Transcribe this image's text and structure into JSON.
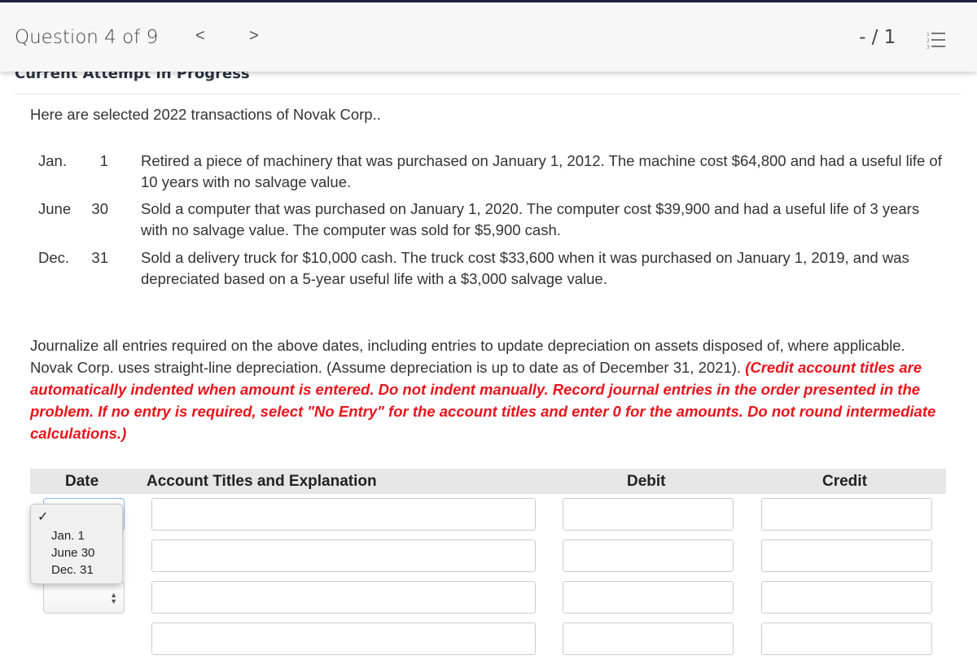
{
  "header": {
    "question_label": "Question 4 of 9",
    "prev": "<",
    "next": ">",
    "score": "- / 1",
    "list_icon": "numbered-list-icon"
  },
  "attempt_label": "Current Attempt in Progress",
  "intro": "Here are selected 2022 transactions of Novak Corp..",
  "transactions": [
    {
      "month": "Jan.",
      "day": "1",
      "text": "Retired a piece of machinery that was purchased on January 1, 2012. The machine cost $64,800 and had a useful life of 10 years with no salvage value."
    },
    {
      "month": "June",
      "day": "30",
      "text": "Sold a computer that was purchased on January 1, 2020. The computer cost $39,900 and had a useful life of 3 years with no salvage value. The computer was sold for $5,900 cash."
    },
    {
      "month": "Dec.",
      "day": "31",
      "text": "Sold a delivery truck for $10,000 cash. The truck cost $33,600 when it was purchased on January 1, 2019, and was depreciated based on a 5-year useful life with a $3,000 salvage value."
    }
  ],
  "instructions": {
    "normal": "Journalize all entries required on the above dates, including entries to update depreciation on assets disposed of, where applicable. Novak Corp. uses straight-line depreciation. (Assume depreciation is up to date as of December 31, 2021). ",
    "emphasis": "(Credit account titles are automatically indented when amount is entered. Do not indent manually. Record journal entries in the order presented in the problem. If no entry is required, select \"No Entry\" for the account titles and enter 0 for the amounts. Do not round intermediate calculations.)"
  },
  "table": {
    "headers": {
      "date": "Date",
      "account": "Account Titles and Explanation",
      "debit": "Debit",
      "credit": "Credit"
    }
  },
  "date_dropdown": {
    "selected": "",
    "options": [
      "Jan. 1",
      "June 30",
      "Dec. 31"
    ]
  }
}
